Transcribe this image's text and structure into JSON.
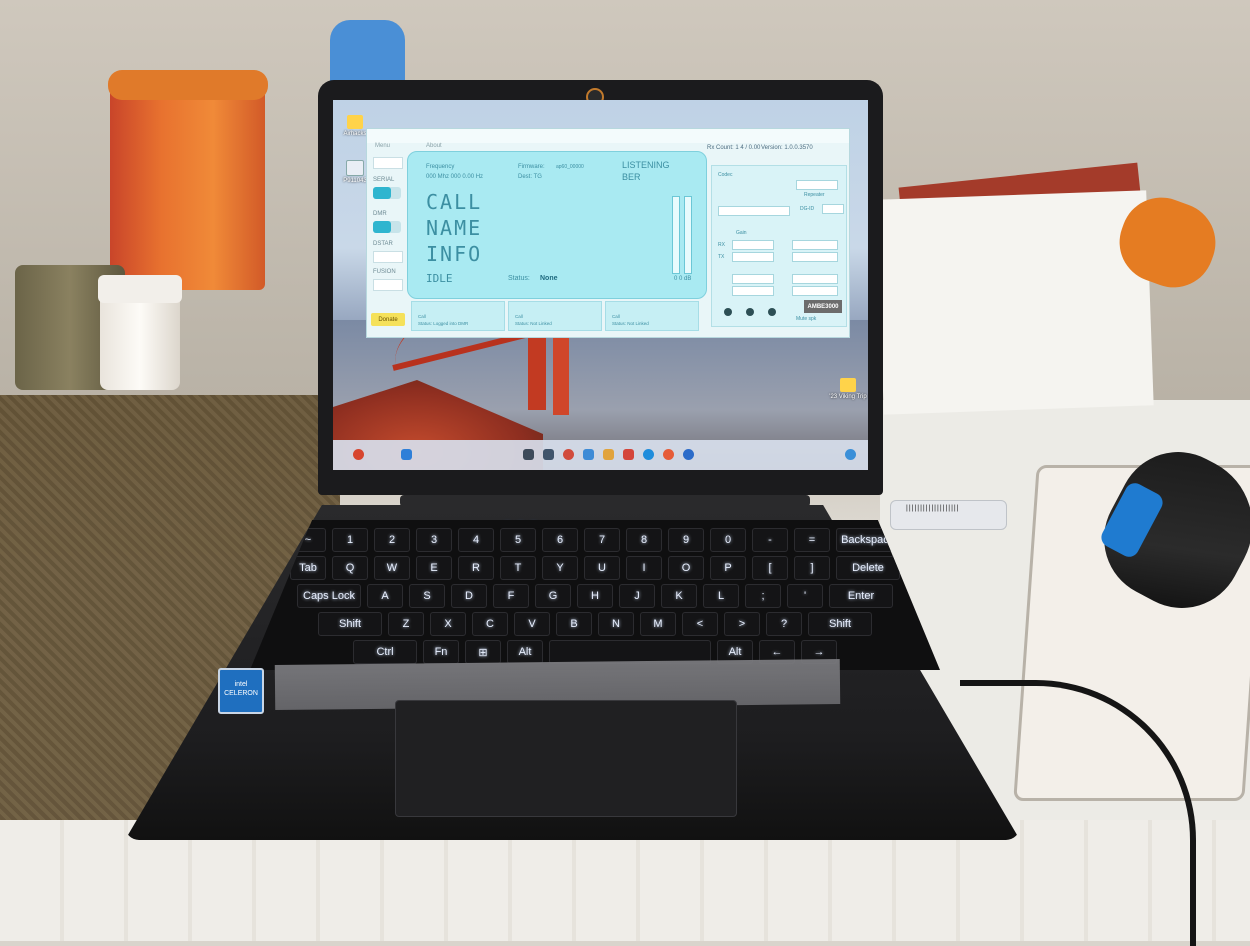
{
  "scene": {
    "usb_label": "|||||||||||||||||||"
  },
  "desktop": {
    "icons": [
      {
        "label": "Airhacks"
      },
      {
        "label": "P911043"
      },
      {
        "label": "'23 Viking Trip"
      }
    ]
  },
  "app": {
    "title": "",
    "menu": [
      "Menu",
      "",
      "About"
    ],
    "status_right": "Rx Count: 1 4 / 0.00",
    "version": "Version: 1.0.0.3570",
    "sidebar": {
      "serial_label": "SERIAL",
      "dmr_label": "DMR",
      "dstar_label": "DSTAR",
      "fusion_label": "FUSION"
    },
    "display": {
      "frequency_label": "Frequency",
      "frequency_value": "000 Mhz 000 0.00 Hz",
      "firmware_label": "Firmware:",
      "firmware_value": "ap60_00000",
      "dest_label": "Dest: TG",
      "listening": "LISTENING",
      "ber": "BER",
      "call": "CALL",
      "name": "NAME",
      "info": "INFO",
      "idle": "IDLE",
      "status_label": "Status:",
      "status_value": "None",
      "db": "0 0 dB"
    },
    "donate_label": "Donate",
    "slots": [
      {
        "title": "Call",
        "status": "Status:  Logged into DMR"
      },
      {
        "title": "Call",
        "status": "Status:  Not Linked"
      },
      {
        "title": "Call",
        "status": "Status:  Not Linked"
      }
    ],
    "panel": {
      "codec_label": "Codec",
      "repeater_label": "Repeater",
      "tg_label": "DG-ID",
      "gain_label": "Gain",
      "rx_label": "RX",
      "tx_label": "TX",
      "ambe_label": "AMBE3000",
      "mute_label": "Mute spk"
    }
  },
  "laptop": {
    "keyboard_rows": [
      [
        "~",
        "1",
        "2",
        "3",
        "4",
        "5",
        "6",
        "7",
        "8",
        "9",
        "0",
        "-",
        "=",
        "Backspace"
      ],
      [
        "Tab",
        "Q",
        "W",
        "E",
        "R",
        "T",
        "Y",
        "U",
        "I",
        "O",
        "P",
        "[",
        "]",
        "Delete"
      ],
      [
        "Caps Lock",
        "A",
        "S",
        "D",
        "F",
        "G",
        "H",
        "J",
        "K",
        "L",
        ";",
        "'",
        "Enter"
      ],
      [
        "Shift",
        "Z",
        "X",
        "C",
        "V",
        "B",
        "N",
        "M",
        "<",
        ">",
        "?",
        "Shift"
      ],
      [
        "Ctrl",
        "Fn",
        "⊞",
        "Alt",
        "",
        "Alt",
        "←",
        "→"
      ]
    ],
    "sticker_text": "intel CELERON"
  }
}
